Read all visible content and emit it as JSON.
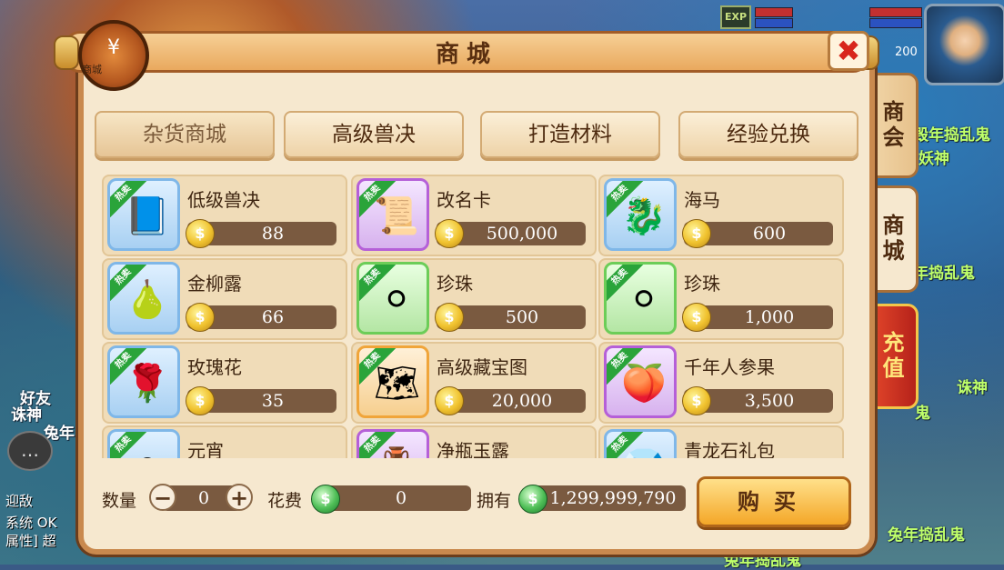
{
  "background": {
    "exp_label": "EXP",
    "level_num": "200",
    "scene_texts": [
      "毁年捣乱鬼",
      "妖神",
      "年捣乱鬼",
      "好友",
      "诛神",
      "兔年",
      "诛神",
      "鬼",
      "兔年捣乱鬼",
      "兔年捣乱鬼"
    ],
    "chat_lines": [
      "迎敌",
      "系统 OK",
      "属性] 超"
    ]
  },
  "panel": {
    "title": "商城",
    "shop_icon_symbol": "¥",
    "shop_icon_label": "商城",
    "close_label": "✖"
  },
  "side_tabs": [
    {
      "label": "商会"
    },
    {
      "label": "商城"
    },
    {
      "label": "充值"
    }
  ],
  "categories": [
    {
      "label": "杂货商城"
    },
    {
      "label": "高级兽决"
    },
    {
      "label": "打造材料"
    },
    {
      "label": "经验兑换"
    }
  ],
  "hot_badge": "热卖",
  "items": [
    {
      "name": "低级兽决",
      "price": "88",
      "frame": "blue",
      "icon": "book-icon",
      "glyph": "📘"
    },
    {
      "name": "改名卡",
      "price": "500,000",
      "frame": "purple",
      "icon": "scroll-icon",
      "glyph": "📜"
    },
    {
      "name": "海马",
      "price": "600",
      "frame": "blue",
      "icon": "seahorse-icon",
      "glyph": "🐉"
    },
    {
      "name": "金柳露",
      "price": "66",
      "frame": "blue",
      "icon": "gourd-icon",
      "glyph": "🍐"
    },
    {
      "name": "珍珠",
      "price": "500",
      "frame": "green",
      "icon": "pearl-icon",
      "glyph": "⚪"
    },
    {
      "name": "珍珠",
      "price": "1,000",
      "frame": "green",
      "icon": "pearl-icon",
      "glyph": "⚪"
    },
    {
      "name": "玫瑰花",
      "price": "35",
      "frame": "blue",
      "icon": "rose-icon",
      "glyph": "🌹"
    },
    {
      "name": "高级藏宝图",
      "price": "20,000",
      "frame": "orange",
      "icon": "treasure-map-icon",
      "glyph": "🗺"
    },
    {
      "name": "千年人参果",
      "price": "3,500",
      "frame": "purple",
      "icon": "ginseng-fruit-icon",
      "glyph": "🍑"
    },
    {
      "name": "元宵",
      "price": "",
      "frame": "blue",
      "icon": "rice-ball-icon",
      "glyph": "⚪"
    },
    {
      "name": "净瓶玉露",
      "price": "",
      "frame": "purple",
      "icon": "vase-icon",
      "glyph": "🏺"
    },
    {
      "name": "青龙石礼包",
      "price": "",
      "frame": "blue",
      "icon": "gift-pack-icon",
      "glyph": "💎"
    }
  ],
  "bottom": {
    "quantity_label": "数量",
    "quantity_value": "0",
    "minus": "−",
    "plus": "+",
    "cost_label": "花费",
    "cost_value": "0",
    "own_label": "拥有",
    "own_value": "1,299,999,790",
    "buy_label": "购买"
  },
  "colors": {
    "panel_bg": "#f6e8cf",
    "border_brown": "#c9894e",
    "price_bar": "#7a5a40",
    "hot_green": "#2aa43a",
    "recharge_red": "#d8301f"
  }
}
